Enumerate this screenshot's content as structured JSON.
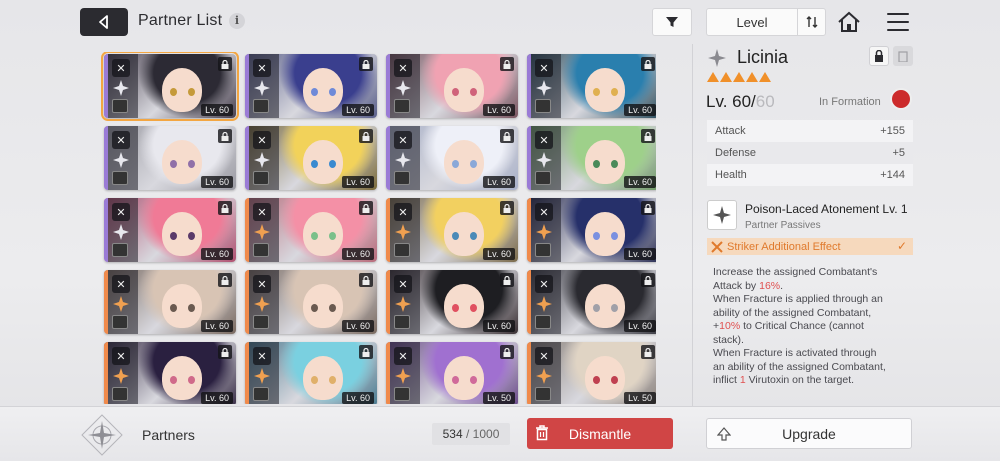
{
  "header": {
    "title": "Partner List",
    "info_icon": "i",
    "sort_label": "Level"
  },
  "partners": [
    {
      "level": "Lv. 60",
      "strip": "#9a7bd6",
      "bg": "#4a4250",
      "hair": "#2c2a34",
      "eyes": "#c59a3a",
      "selected": true
    },
    {
      "level": "Lv. 60",
      "strip": "#9a7bd6",
      "bg": "#5a5f8a",
      "hair": "#3a3f8e",
      "eyes": "#6f8ad8",
      "selected": false
    },
    {
      "level": "Lv. 60",
      "strip": "#9a7bd6",
      "bg": "#7a5560",
      "hair": "#f0a2b2",
      "eyes": "#d0637a",
      "selected": false
    },
    {
      "level": "Lv. 60",
      "strip": "#9a7bd6",
      "bg": "#2f5060",
      "hair": "#2a7fae",
      "eyes": "#e0b050",
      "selected": false
    },
    {
      "level": "Lv. 60",
      "strip": "#9a7bd6",
      "bg": "#9a9aa2",
      "hair": "#e8e8ee",
      "eyes": "#9070a8",
      "selected": false
    },
    {
      "level": "Lv. 60",
      "strip": "#9a7bd6",
      "bg": "#7a6a3a",
      "hair": "#f2d25a",
      "eyes": "#3a8ad0",
      "selected": false
    },
    {
      "level": "Lv. 60",
      "strip": "#9a7bd6",
      "bg": "#a8b0c8",
      "hair": "#eef0f8",
      "eyes": "#8aa8d8",
      "selected": false
    },
    {
      "level": "Lv. 60",
      "strip": "#9a7bd6",
      "bg": "#6f9a66",
      "hair": "#9ed08a",
      "eyes": "#4a8a5a",
      "selected": false
    },
    {
      "level": "Lv. 60",
      "strip": "#9a7bd6",
      "bg": "#b05070",
      "hair": "#f07a96",
      "eyes": "#5a3a6a",
      "selected": false
    },
    {
      "level": "Lv. 60",
      "strip": "#f08a4b",
      "bg": "#b86a7a",
      "hair": "#f490a6",
      "eyes": "#7ac08a",
      "selected": false
    },
    {
      "level": "Lv. 60",
      "strip": "#f08a4b",
      "bg": "#7a6a4a",
      "hair": "#f2d060",
      "eyes": "#4a8ab8",
      "selected": false
    },
    {
      "level": "Lv. 60",
      "strip": "#f08a4b",
      "bg": "#2a2e54",
      "hair": "#26306a",
      "eyes": "#7a90e0",
      "selected": false
    },
    {
      "level": "Lv. 60",
      "strip": "#f08a4b",
      "bg": "#7a6a60",
      "hair": "#d8c4b4",
      "eyes": "#6a5a50",
      "selected": false
    },
    {
      "level": "Lv. 60",
      "strip": "#f08a4b",
      "bg": "#7a6a60",
      "hair": "#d8c4b4",
      "eyes": "#6a5a50",
      "selected": false
    },
    {
      "level": "Lv. 60",
      "strip": "#f08a4b",
      "bg": "#3a3034",
      "hair": "#1e1e22",
      "eyes": "#e05060",
      "selected": false
    },
    {
      "level": "Lv. 60",
      "strip": "#f08a4b",
      "bg": "#3a3a42",
      "hair": "#2a2a30",
      "eyes": "#a0a0a8",
      "selected": false
    },
    {
      "level": "Lv. 60",
      "strip": "#f08a4b",
      "bg": "#3a2f48",
      "hair": "#2a2040",
      "eyes": "#d06a8a",
      "selected": false
    },
    {
      "level": "Lv. 60",
      "strip": "#f08a4b",
      "bg": "#4a7a90",
      "hair": "#7ad0e0",
      "eyes": "#e0b06a",
      "selected": false
    },
    {
      "level": "Lv. 50",
      "strip": "#f08a4b",
      "bg": "#6a4a8a",
      "hair": "#a070d0",
      "eyes": "#d06a9a",
      "selected": false
    },
    {
      "level": "Lv. 50",
      "strip": "#f08a4b",
      "bg": "#8a8078",
      "hair": "#e0d4c4",
      "eyes": "#c04050",
      "selected": false
    }
  ],
  "detail": {
    "name": "Licinia",
    "level_current": "Lv. 60/",
    "level_max": "60",
    "formation": "In Formation",
    "stats": [
      {
        "label": "Attack",
        "value": "+155"
      },
      {
        "label": "Defense",
        "value": "+5"
      },
      {
        "label": "Health",
        "value": "+144"
      }
    ],
    "passive_title": "Poison-Laced Atonement Lv. 1",
    "passive_sub": "Partner Passives",
    "striker_label": "Striker Additional Effect",
    "desc_lines": [
      "Increase the assigned Combatant's",
      "Attack by ",
      "16%",
      ".",
      "When Fracture is applied through an",
      "ability of the assigned Combatant,",
      "+",
      "10%",
      " to Critical Chance (cannot",
      "stack).",
      "When Fracture is activated through",
      "an ability of the assigned Combatant,",
      "inflict ",
      "1",
      " Virutoxin on the target."
    ]
  },
  "bottom": {
    "label": "Partners",
    "count_current": "534",
    "count_sep": " / ",
    "count_max": "1000",
    "dismantle_label": "Dismantle",
    "upgrade_label": "Upgrade"
  },
  "colors": {
    "accent_orange": "#f08a4b",
    "dismantle_red": "#d04545",
    "purple_rarity": "#9a7bd6",
    "selected_outline": "#f3a642"
  }
}
